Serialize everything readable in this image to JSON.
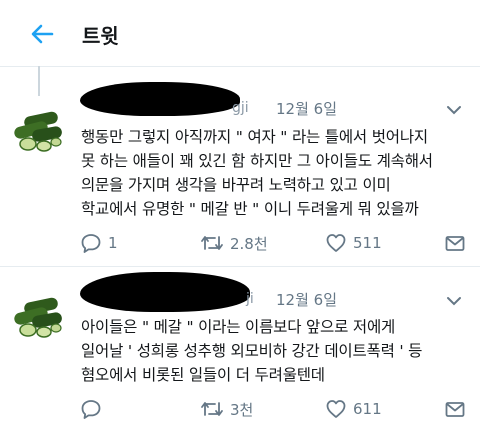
{
  "header": {
    "title": "트윗",
    "back_icon": "arrow-left-icon",
    "accent": "#1da1f2"
  },
  "tweets": [
    {
      "handle_fragment": "gji",
      "date": "12월 6일",
      "text": "행동만 그렇지 아직까지 \" 여자 \" 라는 틀에서 벗어나지\n못 하는 애들이 꽤 있긴 함 하지만 그 아이들도 계속해서\n의문을 가지며 생각을 바꾸려 노력하고 있고 이미\n학교에서 유명한 \" 메갈 반 \" 이니 두려울게 뭐 있을까",
      "reply_count": "1",
      "retweet_count": "2.8천",
      "like_count": "511"
    },
    {
      "handle_fragment": "ji",
      "date": "12월 6일",
      "text": "아이들은 \" 메갈 \" 이라는 이름보다 앞으로 저에게\n일어날 ' 성희롱 성추행 외모비하 강간 데이트폭력 ' 등\n혐오에서 비롯된 일들이 더 두려울텐데",
      "reply_count": "",
      "retweet_count": "3천",
      "like_count": "611"
    }
  ],
  "icons": [
    "reply-icon",
    "retweet-icon",
    "like-icon",
    "share-icon",
    "chevron-down-icon",
    "cucumber-avatar"
  ],
  "colors": {
    "text": "#14171a",
    "muted": "#657786",
    "divider": "#e6ecf0"
  }
}
